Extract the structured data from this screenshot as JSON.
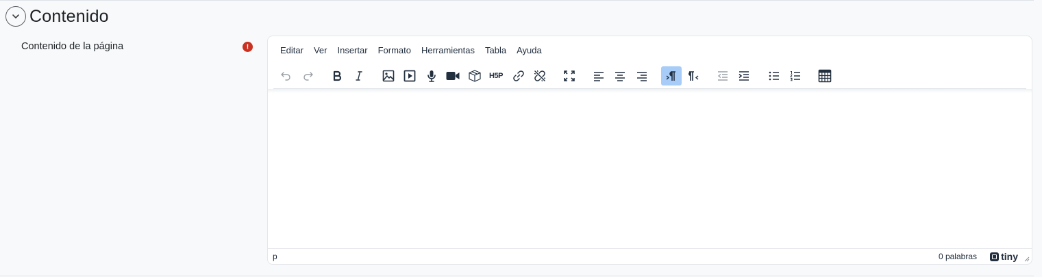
{
  "section": {
    "title": "Contenido",
    "collapse_icon": "chevron-down-icon"
  },
  "field": {
    "label": "Contenido de la página",
    "required_icon": "exclamation-circle-icon",
    "required_symbol": "!",
    "required_color": "#ca3120"
  },
  "editor": {
    "menubar": [
      "Editar",
      "Ver",
      "Insertar",
      "Formato",
      "Herramientas",
      "Tabla",
      "Ayuda"
    ],
    "toolbar_buttons": [
      {
        "name": "undo-icon",
        "state": "disabled"
      },
      {
        "name": "redo-icon",
        "state": "disabled"
      },
      {
        "name": "bold-icon",
        "state": "normal"
      },
      {
        "name": "italic-icon",
        "state": "normal"
      },
      {
        "name": "image-icon",
        "state": "normal"
      },
      {
        "name": "media-icon",
        "state": "normal"
      },
      {
        "name": "record-audio-icon",
        "state": "normal"
      },
      {
        "name": "record-video-icon",
        "state": "normal"
      },
      {
        "name": "content-bank-icon",
        "state": "normal"
      },
      {
        "name": "h5p-icon",
        "state": "normal"
      },
      {
        "name": "link-icon",
        "state": "normal"
      },
      {
        "name": "unlink-icon",
        "state": "normal"
      },
      {
        "name": "fullscreen-icon",
        "state": "normal"
      },
      {
        "name": "align-left-icon",
        "state": "normal"
      },
      {
        "name": "align-center-icon",
        "state": "normal"
      },
      {
        "name": "align-right-icon",
        "state": "normal"
      },
      {
        "name": "ltr-icon",
        "state": "active"
      },
      {
        "name": "rtl-icon",
        "state": "normal"
      },
      {
        "name": "outdent-icon",
        "state": "disabled"
      },
      {
        "name": "indent-icon",
        "state": "normal"
      },
      {
        "name": "bullet-list-icon",
        "state": "normal"
      },
      {
        "name": "numbered-list-icon",
        "state": "normal"
      },
      {
        "name": "table-icon",
        "state": "normal"
      }
    ],
    "h5p_text": "H5P",
    "status": {
      "path": "p",
      "wordcount": "0 palabras",
      "brand": "tiny",
      "brand_icon": "tiny-logo-icon",
      "resize_icon": "resize-handle-icon"
    },
    "active_color": "#a6ccf7"
  }
}
